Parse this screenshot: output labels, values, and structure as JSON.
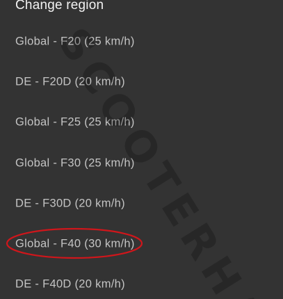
{
  "dialog": {
    "title": "Change region"
  },
  "options": [
    {
      "label": "Global - F20 (25 km/h)"
    },
    {
      "label": "DE - F20D (20 km/h)"
    },
    {
      "label": "Global - F25 (25 km/h)"
    },
    {
      "label": "Global - F30 (25 km/h)"
    },
    {
      "label": "DE - F30D (20 km/h)"
    },
    {
      "label": "Global - F40 (30 km/h)"
    },
    {
      "label": "DE - F40D (20 km/h)"
    }
  ],
  "watermark": {
    "text": "SCOOTERHACK"
  },
  "highlight": {
    "color": "#d0161b",
    "option_index": 5
  }
}
